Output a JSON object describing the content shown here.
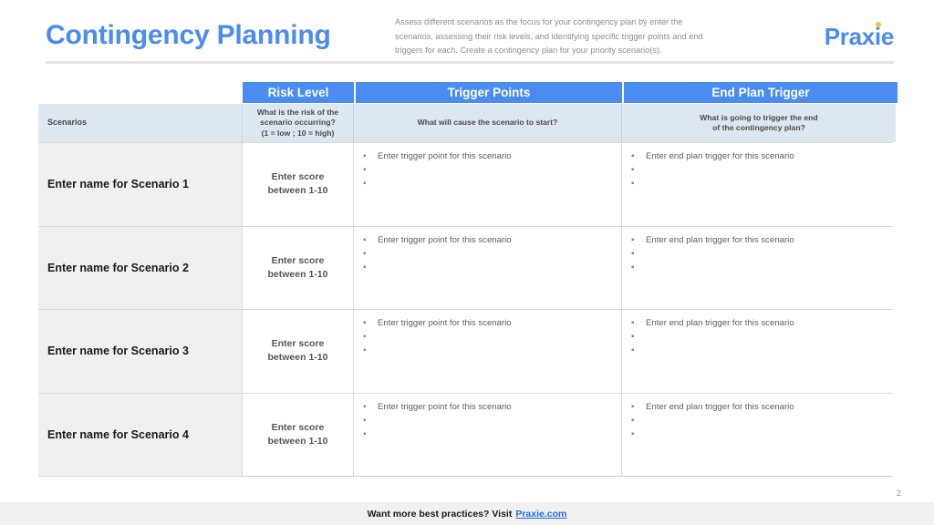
{
  "header": {
    "title": "Contingency Planning",
    "description": "Assess different scenarios as the focus for your contingency plan by enter the scenarios, assessing their risk levels, and identifying specific trigger points and end triggers for each. Create a contingency plan for your priority scenario(s).",
    "brand": {
      "prefix": "Prax",
      "dot_letter": "i",
      "suffix": "e",
      "color": "#4a8cf0",
      "dot_color": "#f5c33b"
    }
  },
  "table": {
    "band_headers": [
      {
        "label": "Risk Level"
      },
      {
        "label": "Trigger Points"
      },
      {
        "label": "End Plan Trigger"
      }
    ],
    "sub_headers": {
      "scenarios": "Scenarios",
      "risk": "What is the risk of the\nscenario occurring?\n(1 = low ; 10 = high)",
      "risk_line1": "What is the risk of the",
      "risk_line2": "scenario occurring?",
      "risk_line3": "(1 = low ; 10 = high)",
      "trigger": "What will cause the scenario to start?",
      "end_line1": "What is going to trigger the end",
      "end_line2": "of the contingency plan?"
    },
    "rows": [
      {
        "name": "Enter name for Scenario 1",
        "score_line1": "Enter score",
        "score_line2": "between 1-10",
        "trigger_bullets": [
          "Enter trigger point for this scenario",
          "",
          ""
        ],
        "end_bullets": [
          "Enter end plan trigger for this scenario",
          "",
          ""
        ]
      },
      {
        "name": "Enter name for Scenario 2",
        "score_line1": "Enter score",
        "score_line2": "between 1-10",
        "trigger_bullets": [
          "Enter trigger point for this scenario",
          "",
          ""
        ],
        "end_bullets": [
          "Enter end plan trigger for this scenario",
          "",
          ""
        ]
      },
      {
        "name": "Enter name for Scenario 3",
        "score_line1": "Enter score",
        "score_line2": "between 1-10",
        "trigger_bullets": [
          "Enter trigger point for this scenario",
          "",
          ""
        ],
        "end_bullets": [
          "Enter end plan trigger for this scenario",
          "",
          ""
        ]
      },
      {
        "name": "Enter name for Scenario 4",
        "score_line1": "Enter score",
        "score_line2": "between 1-10",
        "trigger_bullets": [
          "Enter trigger point for this scenario",
          "",
          ""
        ],
        "end_bullets": [
          "Enter end plan trigger for this scenario",
          "",
          ""
        ]
      }
    ],
    "bullet_glyph": "▪"
  },
  "footer": {
    "text": "Want more best practices? Visit",
    "link_label": "Praxie.com",
    "page_number": "2"
  },
  "colors": {
    "accent_blue": "#4a8cf0",
    "sub_header_blue": "#dde7f2",
    "row_label_gray": "#f0f0f0",
    "footer_gray": "#f1f1f1"
  }
}
